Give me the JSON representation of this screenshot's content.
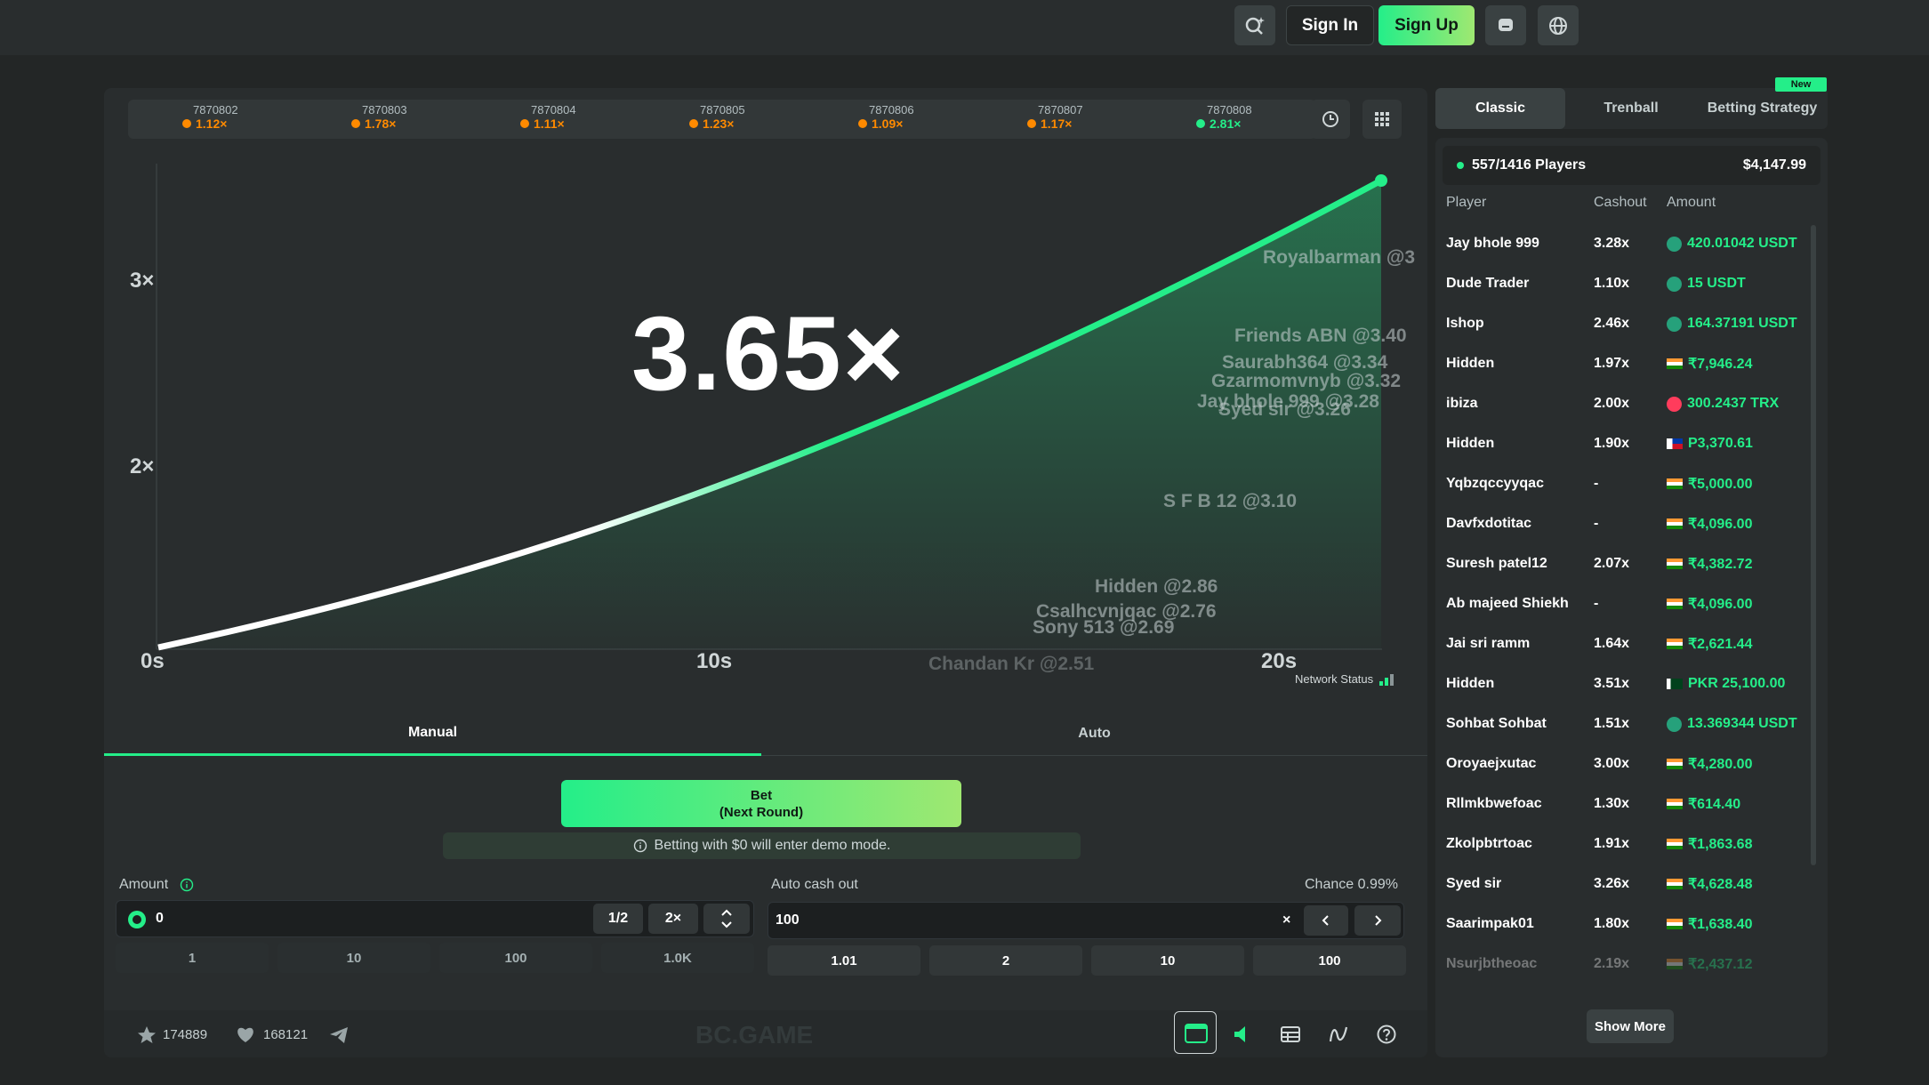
{
  "header": {
    "sign_in": "Sign In",
    "sign_up": "Sign Up"
  },
  "history": [
    {
      "id": "7870802",
      "mult": "1.12×",
      "color": "#ff8a00"
    },
    {
      "id": "7870803",
      "mult": "1.78×",
      "color": "#ff8a00"
    },
    {
      "id": "7870804",
      "mult": "1.11×",
      "color": "#ff8a00"
    },
    {
      "id": "7870805",
      "mult": "1.23×",
      "color": "#ff8a00"
    },
    {
      "id": "7870806",
      "mult": "1.09×",
      "color": "#ff8a00"
    },
    {
      "id": "7870807",
      "mult": "1.17×",
      "color": "#ff8a00"
    },
    {
      "id": "7870808",
      "mult": "2.81×",
      "color": "#24ee89"
    }
  ],
  "game": {
    "multiplier": "3.65×",
    "y_ticks": [
      "3×",
      "2×"
    ],
    "x_ticks": [
      "0s",
      "10s",
      "20s"
    ],
    "cashouts": [
      "Royalbarman @3",
      "Friends ABN @3.40",
      "Saurabh364 @3.34",
      "Gzarmomvnyb @3.32",
      "Jay bhole 999 @3.28",
      "Syed sir @3.26",
      "S F B 12 @3.10",
      "Hidden @2.86",
      "Csalhcvnjqac @2.76",
      "Sony 513 @2.69",
      "Chandan Kr @2.51"
    ],
    "network_status": "Network Status"
  },
  "bet_panel": {
    "tab_manual": "Manual",
    "tab_auto": "Auto",
    "bet_line1": "Bet",
    "bet_line2": "(Next Round)",
    "demo_notice": "Betting with $0 will enter demo mode.",
    "amount_label": "Amount",
    "amount_value": "0",
    "half": "1/2",
    "double": "2×",
    "amount_quick": [
      "1",
      "10",
      "100",
      "1.0K"
    ],
    "autocash_label": "Auto cash out",
    "chance_label": "Chance 0.99%",
    "autocash_value": "100",
    "autocash_unit": "×",
    "autocash_quick": [
      "1.01",
      "2",
      "10",
      "100"
    ]
  },
  "footer": {
    "stars": "174889",
    "likes": "168121",
    "watermark": "BC.GAME"
  },
  "sidebar": {
    "tabs": [
      "Classic",
      "Trenball",
      "Betting Strategy"
    ],
    "new_badge": "New",
    "players_count": "557/1416 Players",
    "total": "$4,147.99",
    "col_player": "Player",
    "col_cashout": "Cashout",
    "col_amount": "Amount",
    "show_more": "Show More",
    "players": [
      {
        "name": "Jay bhole 999",
        "cashout": "3.28x",
        "amount": "420.01042 USDT",
        "icon": "usdt"
      },
      {
        "name": "Dude Trader",
        "cashout": "1.10x",
        "amount": "15 USDT",
        "icon": "usdt"
      },
      {
        "name": "Ishop",
        "cashout": "2.46x",
        "amount": "164.37191 USDT",
        "icon": "usdt"
      },
      {
        "name": "Hidden",
        "cashout": "1.97x",
        "amount": "₹7,946.24",
        "icon": "inr"
      },
      {
        "name": "ibiza",
        "cashout": "2.00x",
        "amount": "300.2437 TRX",
        "icon": "trx"
      },
      {
        "name": "Hidden",
        "cashout": "1.90x",
        "amount": "P3,370.61",
        "icon": "php"
      },
      {
        "name": "Yqbzqccyyqac",
        "cashout": "-",
        "amount": "₹5,000.00",
        "icon": "inr"
      },
      {
        "name": "Davfxdotitac",
        "cashout": "-",
        "amount": "₹4,096.00",
        "icon": "inr"
      },
      {
        "name": "Suresh patel12",
        "cashout": "2.07x",
        "amount": "₹4,382.72",
        "icon": "inr"
      },
      {
        "name": "Ab majeed Shiekh",
        "cashout": "-",
        "amount": "₹4,096.00",
        "icon": "inr"
      },
      {
        "name": "Jai sri ramm",
        "cashout": "1.64x",
        "amount": "₹2,621.44",
        "icon": "inr"
      },
      {
        "name": "Hidden",
        "cashout": "3.51x",
        "amount": "PKR 25,100.00",
        "icon": "pkr"
      },
      {
        "name": "Sohbat Sohbat",
        "cashout": "1.51x",
        "amount": "13.369344 USDT",
        "icon": "usdt"
      },
      {
        "name": "Oroyaejxutac",
        "cashout": "3.00x",
        "amount": "₹4,280.00",
        "icon": "inr"
      },
      {
        "name": "Rllmkbwefoac",
        "cashout": "1.30x",
        "amount": "₹614.40",
        "icon": "inr"
      },
      {
        "name": "Zkolpbtrtoac",
        "cashout": "1.91x",
        "amount": "₹1,863.68",
        "icon": "inr"
      },
      {
        "name": "Syed sir",
        "cashout": "3.26x",
        "amount": "₹4,628.48",
        "icon": "inr"
      },
      {
        "name": "Saarimpak01",
        "cashout": "1.80x",
        "amount": "₹1,638.40",
        "icon": "inr"
      },
      {
        "name": "Nsurjbtheoac",
        "cashout": "2.19x",
        "amount": "₹2,437.12",
        "icon": "inr"
      }
    ]
  }
}
